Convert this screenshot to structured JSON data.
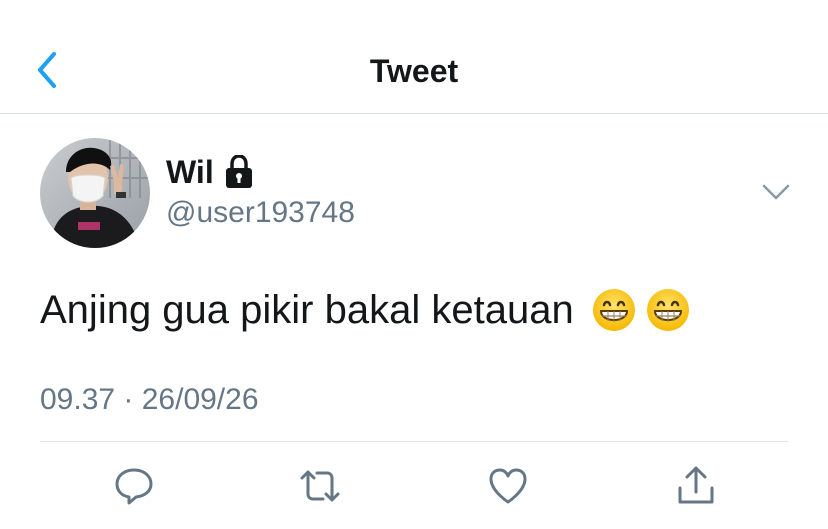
{
  "header": {
    "title": "Tweet",
    "back_icon": "chevron-left-icon"
  },
  "author": {
    "display_name": "Wil",
    "username": "@user193748",
    "protected_icon": "lock-icon",
    "menu_icon": "chevron-down-icon"
  },
  "tweet": {
    "text": "Anjing gua pikir bakal ketauan",
    "emojis": [
      "grinning-face-icon",
      "grinning-face-icon"
    ],
    "timestamp": "09.37 · 26/09/26"
  },
  "actions": {
    "reply_icon": "reply-icon",
    "retweet_icon": "retweet-icon",
    "like_icon": "heart-icon",
    "share_icon": "share-icon"
  },
  "colors": {
    "accent": "#1da1f2",
    "text_primary": "#14171a",
    "text_secondary": "#657786",
    "divider": "#e1e8ed"
  }
}
